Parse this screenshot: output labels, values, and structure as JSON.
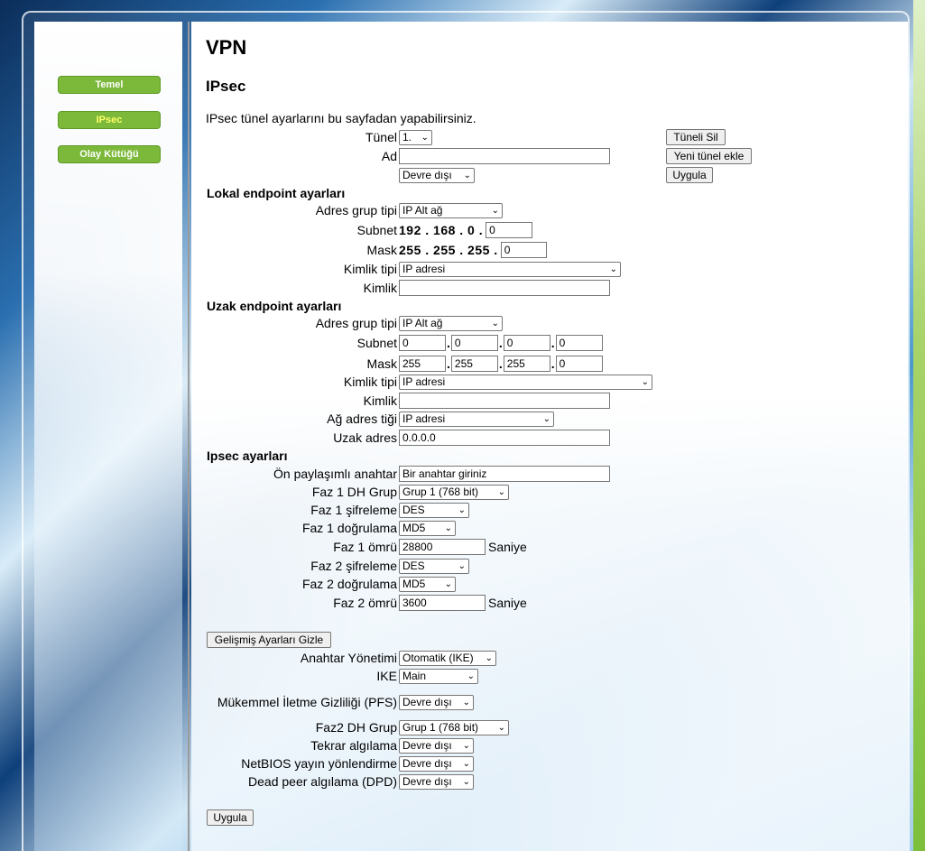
{
  "nav": {
    "items": [
      "Temel",
      "IPsec",
      "Olay Kütüğü"
    ],
    "active": "IPsec"
  },
  "page": {
    "title": "VPN",
    "subtitle": "IPsec",
    "intro": "IPsec tünel ayarlarını bu sayfadan yapabilirsiniz."
  },
  "tunnel": {
    "tunnel_label": "Tünel",
    "tunnel_value": "1.",
    "name_label": "Ad",
    "name_value": "",
    "status_value": "Devre dışı",
    "delete_button": "Tüneli Sil",
    "add_button": "Yeni tünel ekle",
    "apply_button": "Uygula"
  },
  "local": {
    "title": "Lokal endpoint ayarları",
    "group_type_label": "Adres grup tipi",
    "group_type_value": "IP Alt ağ",
    "subnet_label": "Subnet",
    "subnet_prefix": "192 . 168 . 0 .",
    "subnet_last": "0",
    "mask_label": "Mask",
    "mask_prefix": "255 . 255 . 255 .",
    "mask_last": "0",
    "id_type_label": "Kimlik tipi",
    "id_type_value": "IP adresi",
    "id_label": "Kimlik",
    "id_value": ""
  },
  "remote": {
    "title": "Uzak endpoint ayarları",
    "group_type_label": "Adres grup tipi",
    "group_type_value": "IP Alt ağ",
    "subnet_label": "Subnet",
    "subnet": [
      "0",
      "0",
      "0",
      "0"
    ],
    "mask_label": "Mask",
    "mask": [
      "255",
      "255",
      "255",
      "0"
    ],
    "id_type_label": "Kimlik tipi",
    "id_type_value": "IP adresi",
    "id_label": "Kimlik",
    "id_value": "",
    "net_addr_type_label": "Ağ adres tiği",
    "net_addr_type_value": "IP adresi",
    "remote_addr_label": "Uzak adres",
    "remote_addr_value": "0.0.0.0"
  },
  "ipsec": {
    "title": "Ipsec ayarları",
    "psk_label": "Ön paylaşımlı anahtar",
    "psk_value": "Bir anahtar giriniz",
    "p1_dh_label": "Faz 1 DH Grup",
    "p1_dh_value": "Grup 1 (768 bit)",
    "p1_enc_label": "Faz 1 şifreleme",
    "p1_enc_value": "DES",
    "p1_auth_label": "Faz 1 doğrulama",
    "p1_auth_value": "MD5",
    "p1_life_label": "Faz 1 ömrü",
    "p1_life_value": "28800",
    "seconds": "Saniye",
    "p2_enc_label": "Faz 2 şifreleme",
    "p2_enc_value": "DES",
    "p2_auth_label": "Faz 2 doğrulama",
    "p2_auth_value": "MD5",
    "p2_life_label": "Faz 2 ömrü",
    "p2_life_value": "3600"
  },
  "advanced": {
    "toggle_button": "Gelişmiş Ayarları Gizle",
    "key_mgmt_label": "Anahtar Yönetimi",
    "key_mgmt_value": "Otomatik (IKE)",
    "ike_label": "IKE",
    "ike_value": "Main",
    "pfs_label": "Mükemmel İletme Gizliliği (PFS)",
    "pfs_value": "Devre dışı",
    "p2_dh_label": "Faz2 DH Grup",
    "p2_dh_value": "Grup 1 (768 bit)",
    "replay_label": "Tekrar algılama",
    "replay_value": "Devre dışı",
    "netbios_label": "NetBIOS yayın yönlendirme",
    "netbios_value": "Devre dışı",
    "dpd_label": "Dead peer algılama (DPD)",
    "dpd_value": "Devre dışı",
    "apply_button": "Uygula"
  },
  "icons": {
    "dropdown": "chevron-down-icon"
  }
}
